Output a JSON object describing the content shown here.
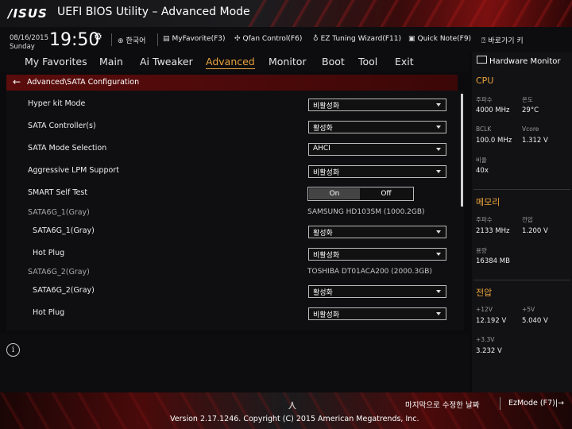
{
  "header": {
    "brand": "/ISUS",
    "title": "UEFI BIOS Utility – Advanced Mode"
  },
  "status": {
    "date": "08/16/2015",
    "day": "Sunday",
    "time": "19:50",
    "language": "한국어",
    "tools": [
      {
        "label": "MyFavorite(F3)",
        "icon": "favorite-icon"
      },
      {
        "label": "Qfan Control(F6)",
        "icon": "fan-icon"
      },
      {
        "label": "EZ Tuning Wizard(F11)",
        "icon": "bulb-icon"
      },
      {
        "label": "Quick Note(F9)",
        "icon": "note-icon"
      },
      {
        "label": "바로가기 키",
        "icon": "help-icon"
      }
    ]
  },
  "menu": {
    "items": [
      "My Favorites",
      "Main",
      "Ai Tweaker",
      "Advanced",
      "Monitor",
      "Boot",
      "Tool",
      "Exit"
    ],
    "active": "Advanced"
  },
  "breadcrumb": "Advanced\\SATA Configuration",
  "settings": [
    {
      "label": "Hyper kit Mode",
      "value": "비활성화",
      "kind": "select"
    },
    {
      "label": "SATA Controller(s)",
      "value": "활성화",
      "kind": "select"
    },
    {
      "label": "SATA Mode Selection",
      "value": "AHCI",
      "kind": "select"
    },
    {
      "label": "Aggressive LPM Support",
      "value": "비활성화",
      "kind": "select"
    },
    {
      "label": "SMART Self Test",
      "on": "On",
      "off": "Off",
      "selected": "On",
      "kind": "toggle"
    },
    {
      "label": "SATA6G_1(Gray)",
      "value": "SAMSUNG HD103SM (1000.2GB)",
      "kind": "info"
    },
    {
      "label": "SATA6G_1(Gray)",
      "value": "활성화",
      "kind": "select"
    },
    {
      "label": "Hot Plug",
      "value": "비활성화",
      "kind": "select"
    },
    {
      "label": "SATA6G_2(Gray)",
      "value": "TOSHIBA DT01ACA200 (2000.3GB)",
      "kind": "info"
    },
    {
      "label": "SATA6G_2(Gray)",
      "value": "활성화",
      "kind": "select"
    },
    {
      "label": "Hot Plug",
      "value": "비활성화",
      "kind": "select"
    }
  ],
  "hardware_monitor": {
    "title": "Hardware Monitor",
    "cpu": {
      "heading": "CPU",
      "freq_label": "주파수",
      "freq": "4000 MHz",
      "temp_label": "온도",
      "temp": "29°C",
      "bclk_label": "BCLK",
      "bclk": "100.0 MHz",
      "vcore_label": "Vcore",
      "vcore": "1.312 V",
      "ratio_label": "비율",
      "ratio": "40x"
    },
    "memory": {
      "heading": "메모리",
      "freq_label": "주파수",
      "freq": "2133 MHz",
      "volt_label": "전압",
      "volt": "1.200 V",
      "cap_label": "용량",
      "cap": "16384 MB"
    },
    "voltage": {
      "heading": "전압",
      "v12_label": "+12V",
      "v12": "12.192 V",
      "v5_label": "+5V",
      "v5": "5.040 V",
      "v33_label": "+3.3V",
      "v33": "3.232 V"
    }
  },
  "footer": {
    "last_modified": "마지막으로 수정한 날짜",
    "ezmode": "EzMode (F7)|→",
    "version": "Version 2.17.1246. Copyright (C) 2015 American Megatrends, Inc."
  }
}
